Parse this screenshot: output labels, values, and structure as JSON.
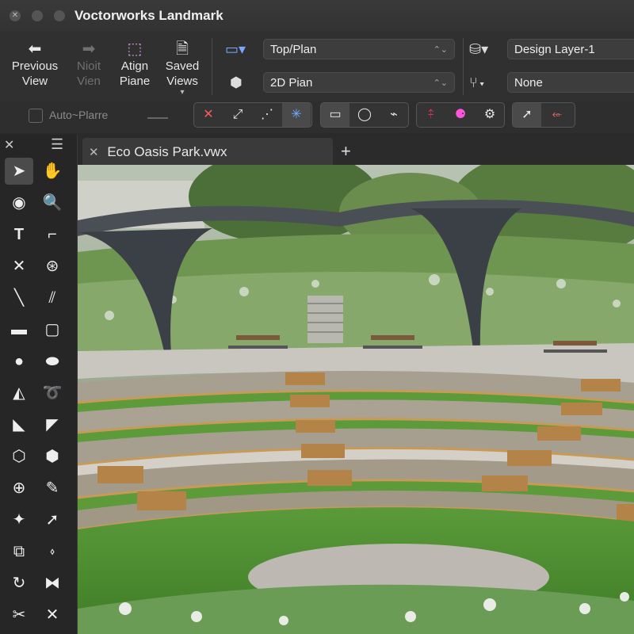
{
  "window": {
    "title": "Voctorworks Landmark"
  },
  "toolbar": {
    "previous_view": {
      "line1": "Previous",
      "line2": "View"
    },
    "next_view": {
      "line1": "Nioit",
      "line2": "Vien"
    },
    "align_plane": {
      "line1": "Atign",
      "line2": "Piane"
    },
    "saved_views": {
      "line1": "Saved",
      "line2": "Views"
    },
    "view_dropdown": "Top/Plan",
    "render_dropdown": "2D Pian",
    "layer_dropdown": "Design Layer-1",
    "class_dropdown": "None"
  },
  "row2": {
    "auto_plane": "Auto~Plarre"
  },
  "document": {
    "tab_title": "Eco Oasis Park.vwx",
    "add_tab": "+"
  }
}
